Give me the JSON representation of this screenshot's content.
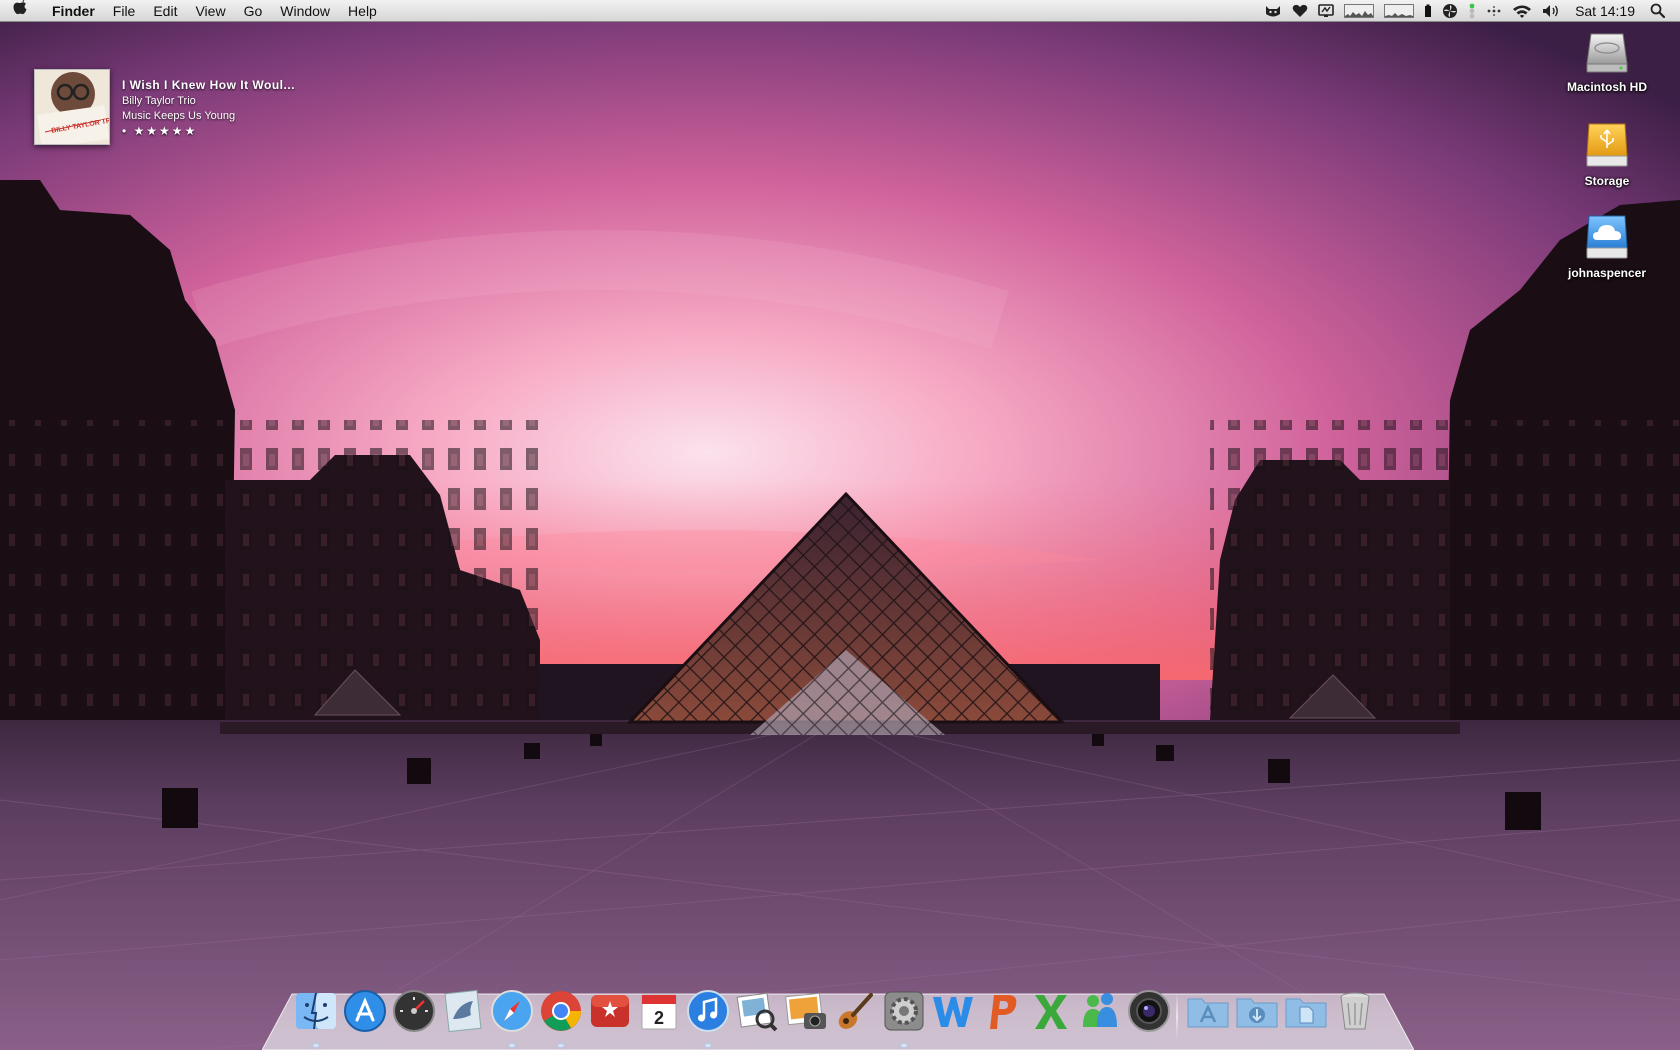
{
  "menubar": {
    "app_name": "Finder",
    "menus": [
      "File",
      "Edit",
      "View",
      "Go",
      "Window",
      "Help"
    ],
    "clock": "Sat 14:19",
    "status_icons": [
      "cat-icon",
      "heart-icon",
      "monitor-icon",
      "cpu-graph-icon",
      "network-graph-icon",
      "battery-icon",
      "fan-icon",
      "status-light-icon",
      "menu-dots-icon",
      "wifi-icon",
      "volume-icon",
      "spotlight-icon"
    ]
  },
  "now_playing": {
    "title": "I Wish I Knew How It Woul...",
    "artist": "Billy Taylor Trio",
    "album": "Music Keeps Us Young",
    "rating": "• ★★★★★",
    "album_art_text": "BILLY TAYLOR TRIO"
  },
  "desktop_icons": [
    {
      "label": "Macintosh HD",
      "icon": "hard-drive-icon"
    },
    {
      "label": "Storage",
      "icon": "usb-drive-icon"
    },
    {
      "label": "johnaspencer",
      "icon": "cloud-drive-icon"
    }
  ],
  "dock": {
    "items": [
      "finder-icon",
      "app-store-icon",
      "dashboard-icon",
      "twitter-bird-icon",
      "safari-icon",
      "chrome-icon",
      "wunderlist-icon",
      "calendar-icon",
      "itunes-icon",
      "preview-icon",
      "iphoto-icon",
      "garageband-icon",
      "system-preferences-icon",
      "word-icon",
      "powerpoint-icon",
      "excel-icon",
      "messenger-icon",
      "photo-booth-icon"
    ],
    "calendar_day": "2",
    "stacks": [
      "applications-folder-icon",
      "downloads-folder-icon",
      "documents-folder-icon"
    ],
    "trash": "trash-icon"
  },
  "colors": {
    "sky_top": "#7a3a78",
    "sky_glow": "#f4a6c2",
    "horizon": "#f26f7e",
    "ground": "#6e4a72"
  }
}
